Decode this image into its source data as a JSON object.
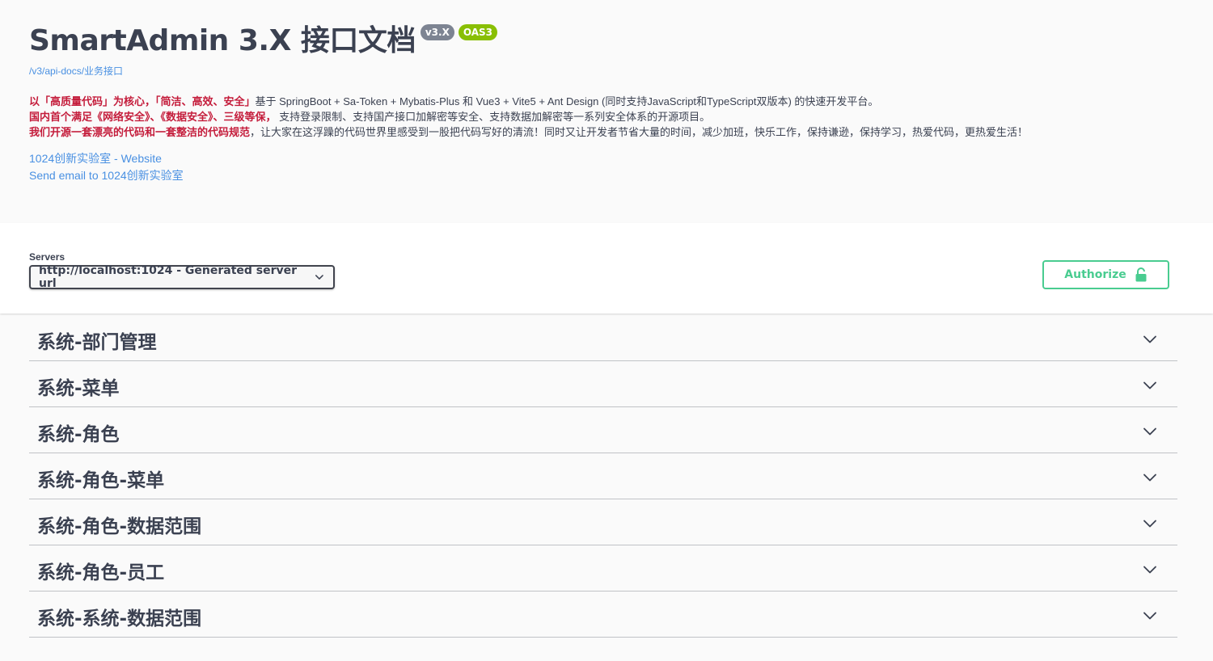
{
  "info": {
    "title": "SmartAdmin 3.X 接口文档",
    "version_badge": "v3.X",
    "oas_badge": "OAS3",
    "spec_url": "/v3/api-docs/业务接口",
    "description": {
      "line1_red": "以「高质量代码」为核心，「简洁、高效、安全」",
      "line1_rest": "基于 SpringBoot + Sa-Token + Mybatis-Plus 和 Vue3 + Vite5 + Ant Design (同时支持JavaScript和TypeScript双版本) 的快速开发平台。",
      "line2_red": "国内首个满足《网络安全》、《数据安全》、三级等保，",
      "line2_rest": " 支持登录限制、支持国产接口加解密等安全、支持数据加解密等一系列安全体系的开源项目。",
      "line3_red": "我们开源一套漂亮的代码和一套整洁的代码规范",
      "line3_rest": "，让大家在这浮躁的代码世界里感受到一股把代码写好的清流！同时又让开发者节省大量的时间，减少加班，快乐工作，保持谦逊，保持学习，热爱代码，更热爱生活！"
    },
    "website_link": "1024创新实验室 - Website",
    "email_link": "Send email to 1024创新实验室"
  },
  "servers": {
    "label": "Servers",
    "selected": "http://localhost:1024 - Generated server url"
  },
  "authorize": {
    "label": "Authorize"
  },
  "tags": [
    {
      "name": "系统-部门管理"
    },
    {
      "name": "系统-菜单"
    },
    {
      "name": "系统-角色"
    },
    {
      "name": "系统-角色-菜单"
    },
    {
      "name": "系统-角色-数据范围"
    },
    {
      "name": "系统-角色-员工"
    },
    {
      "name": "系统-系统-数据范围"
    }
  ],
  "colors": {
    "text": "#3b4151",
    "link": "#4990e2",
    "highlight_red": "#c41c3b",
    "authorize_green": "#49cc90",
    "version_badge": "#7d8492",
    "oas_badge": "#89bf04"
  },
  "icons": {
    "dropdown": "chevron-down-icon",
    "authorize": "unlocked-padlock-icon",
    "tag_toggle": "chevron-down-icon"
  }
}
